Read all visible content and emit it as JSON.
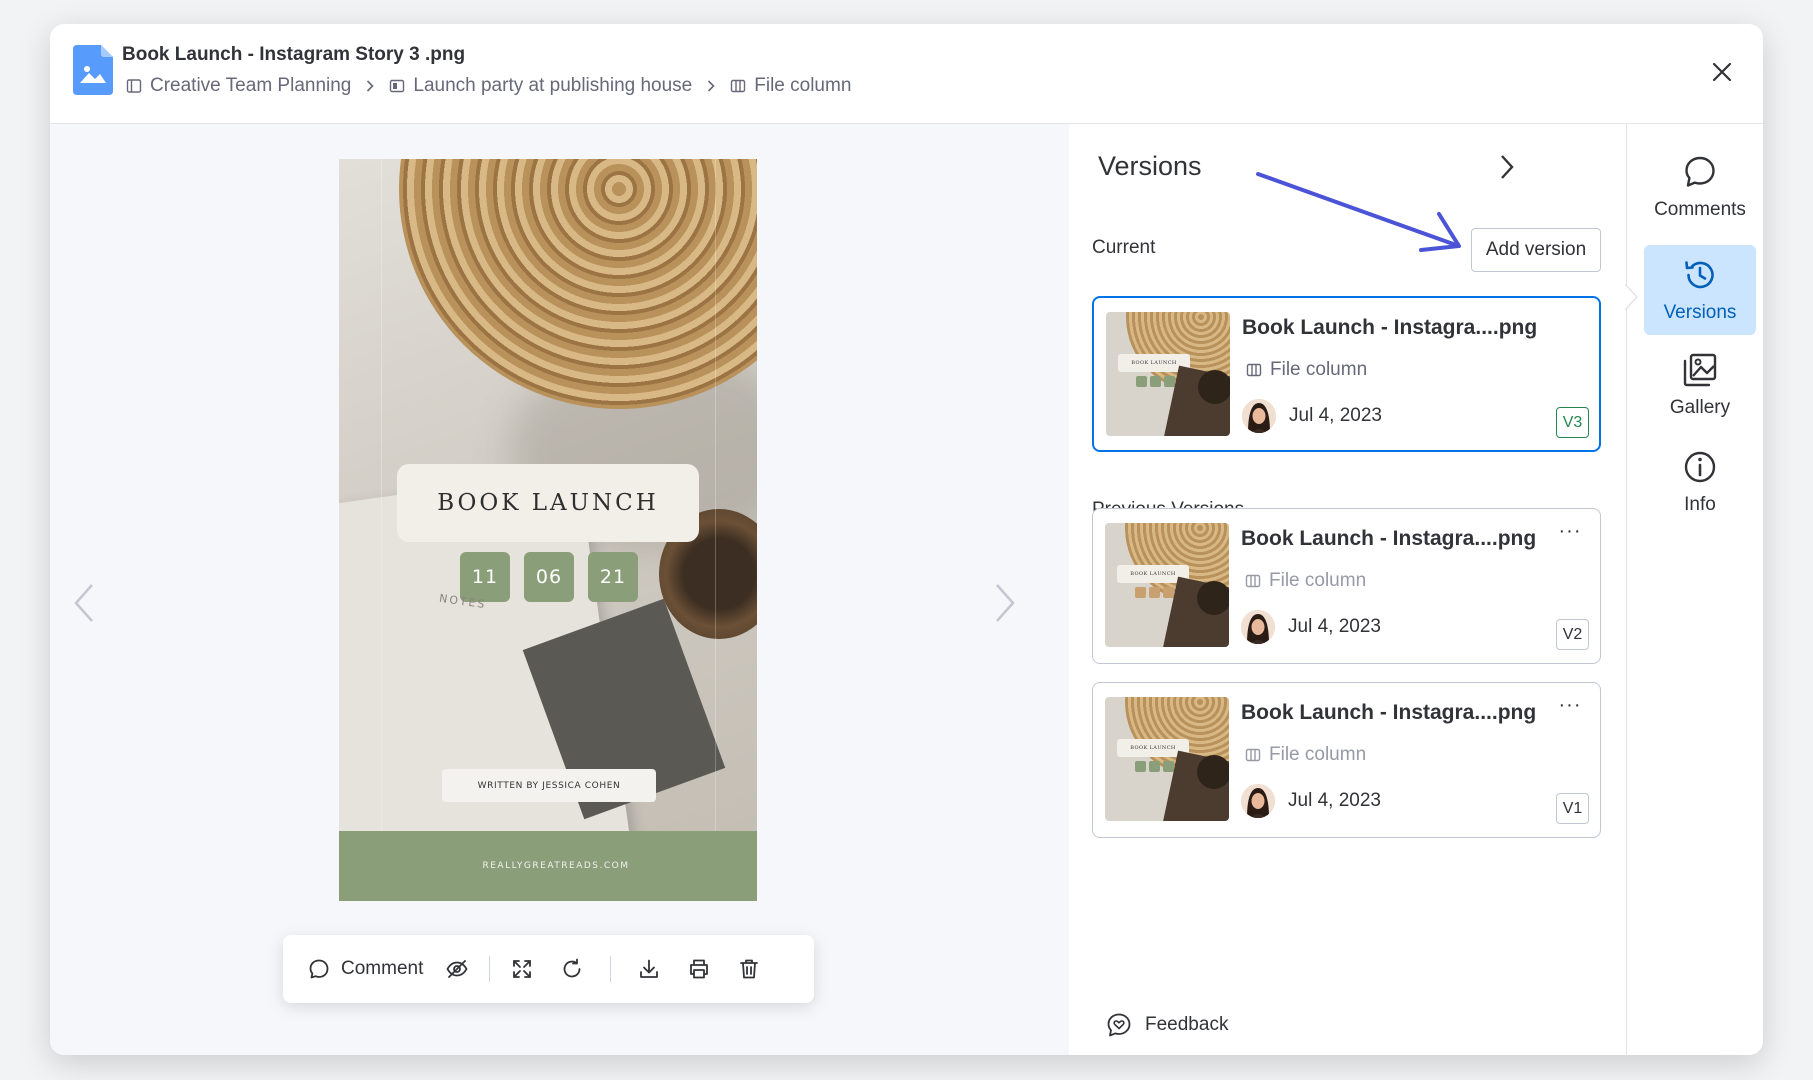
{
  "header": {
    "file_title": "Book Launch - Instagram Story 3 .png",
    "breadcrumb": [
      "Creative Team Planning",
      "Launch party at publishing house",
      "File column"
    ]
  },
  "preview": {
    "story": {
      "title": "BOOK LAUNCH",
      "dates": [
        "11",
        "06",
        "21"
      ],
      "notes": "NOTES",
      "author": "WRITTEN BY JESSICA COHEN",
      "website": "REALLYGREATREADS.COM"
    },
    "toolbar": {
      "comment_label": "Comment",
      "icons": [
        "comment-icon",
        "eye-hidden-icon",
        "fullscreen-icon",
        "rotate-icon",
        "download-icon",
        "print-icon",
        "trash-icon"
      ]
    }
  },
  "versions": {
    "title": "Versions",
    "current_label": "Current",
    "add_version_label": "Add version",
    "previous_label": "Previous Versions",
    "current": {
      "name": "Book Launch - Instagra....png",
      "column": "File column",
      "date": "Jul 4, 2023",
      "badge": "V3",
      "thumb_label": "BOOK LAUNCH"
    },
    "previous": [
      {
        "name": "Book Launch - Instagra....png",
        "column": "File column",
        "date": "Jul 4, 2023",
        "badge": "V2",
        "more": "···",
        "thumb_label": "BOOK LAUNCH"
      },
      {
        "name": "Book Launch - Instagra....png",
        "column": "File column",
        "date": "Jul 4, 2023",
        "badge": "V1",
        "more": "···",
        "thumb_label": "BOOK LAUNCH"
      }
    ],
    "feedback_label": "Feedback"
  },
  "rail": {
    "items": [
      {
        "label": "Comments",
        "icon": "comment-bubble-icon"
      },
      {
        "label": "Versions",
        "icon": "history-icon",
        "active": true
      },
      {
        "label": "Gallery",
        "icon": "gallery-icon"
      },
      {
        "label": "Info",
        "icon": "info-icon"
      }
    ]
  },
  "colors": {
    "accent": "#0073ea",
    "active_bg": "#cce5ff",
    "badge_current": "#258750",
    "annotation_arrow": "#4b53d6",
    "story_green": "#8b9e7a"
  }
}
